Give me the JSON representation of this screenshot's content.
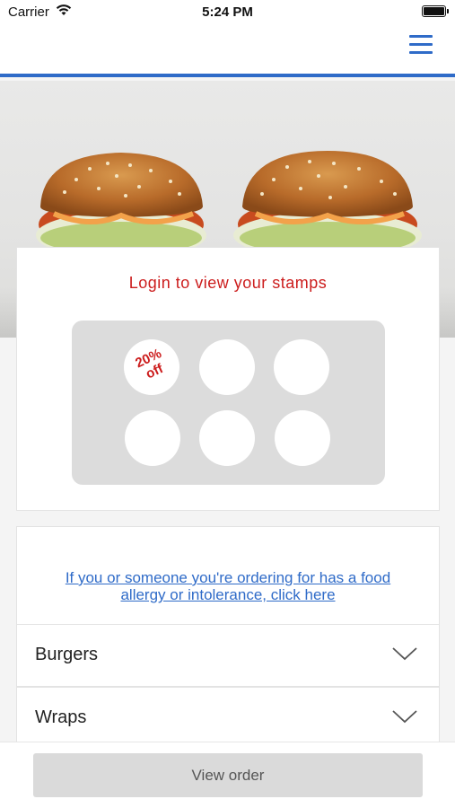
{
  "status_bar": {
    "carrier": "Carrier",
    "time": "5:24 PM"
  },
  "nav": {
    "menu_icon": "hamburger-menu-icon",
    "accent_color": "#2f6bc8"
  },
  "hero": {
    "image": "two-burgers-photo"
  },
  "stamps": {
    "login_text": "Login to view your stamps",
    "reward_label_line1": "20%",
    "reward_label_line2": "off",
    "total_slots": 6
  },
  "allergy": {
    "link_line1": "If you or someone you're ordering for has a food",
    "link_line2": "allergy or intolerance, click here"
  },
  "categories": [
    {
      "label": "Burgers",
      "icon": "chevron-down-icon"
    },
    {
      "label": "Wraps",
      "icon": "chevron-down-icon"
    }
  ],
  "bottom": {
    "view_order_label": "View order"
  }
}
